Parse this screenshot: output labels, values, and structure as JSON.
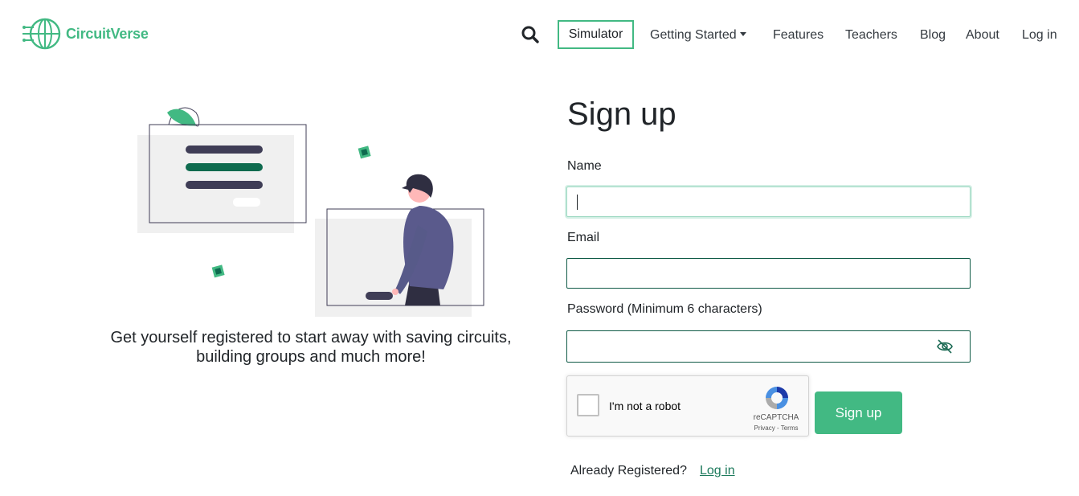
{
  "brand": {
    "name": "CircuitVerse",
    "color": "#42b983"
  },
  "nav": {
    "search_icon": "search-icon",
    "simulator": "Simulator",
    "getting_started": "Getting Started",
    "features": "Features",
    "teachers": "Teachers",
    "blog": "Blog",
    "about": "About",
    "login": "Log in"
  },
  "hero": {
    "tagline_line1": "Get yourself registered to start away with saving circuits,",
    "tagline_line2": "building groups and much more!"
  },
  "form": {
    "title": "Sign up",
    "name_label": "Name",
    "name_value": "",
    "email_label": "Email",
    "email_value": "",
    "password_label": "Password (Minimum 6 characters)",
    "password_value": "",
    "password_toggle_icon": "eye-slash-icon",
    "submit_label": "Sign up"
  },
  "captcha": {
    "label": "I'm not a robot",
    "brand": "reCAPTCHA",
    "privacy": "Privacy",
    "separator": " - ",
    "terms": "Terms",
    "checked": false
  },
  "footer": {
    "already_text": "Already Registered?",
    "login_link": "Log in"
  }
}
